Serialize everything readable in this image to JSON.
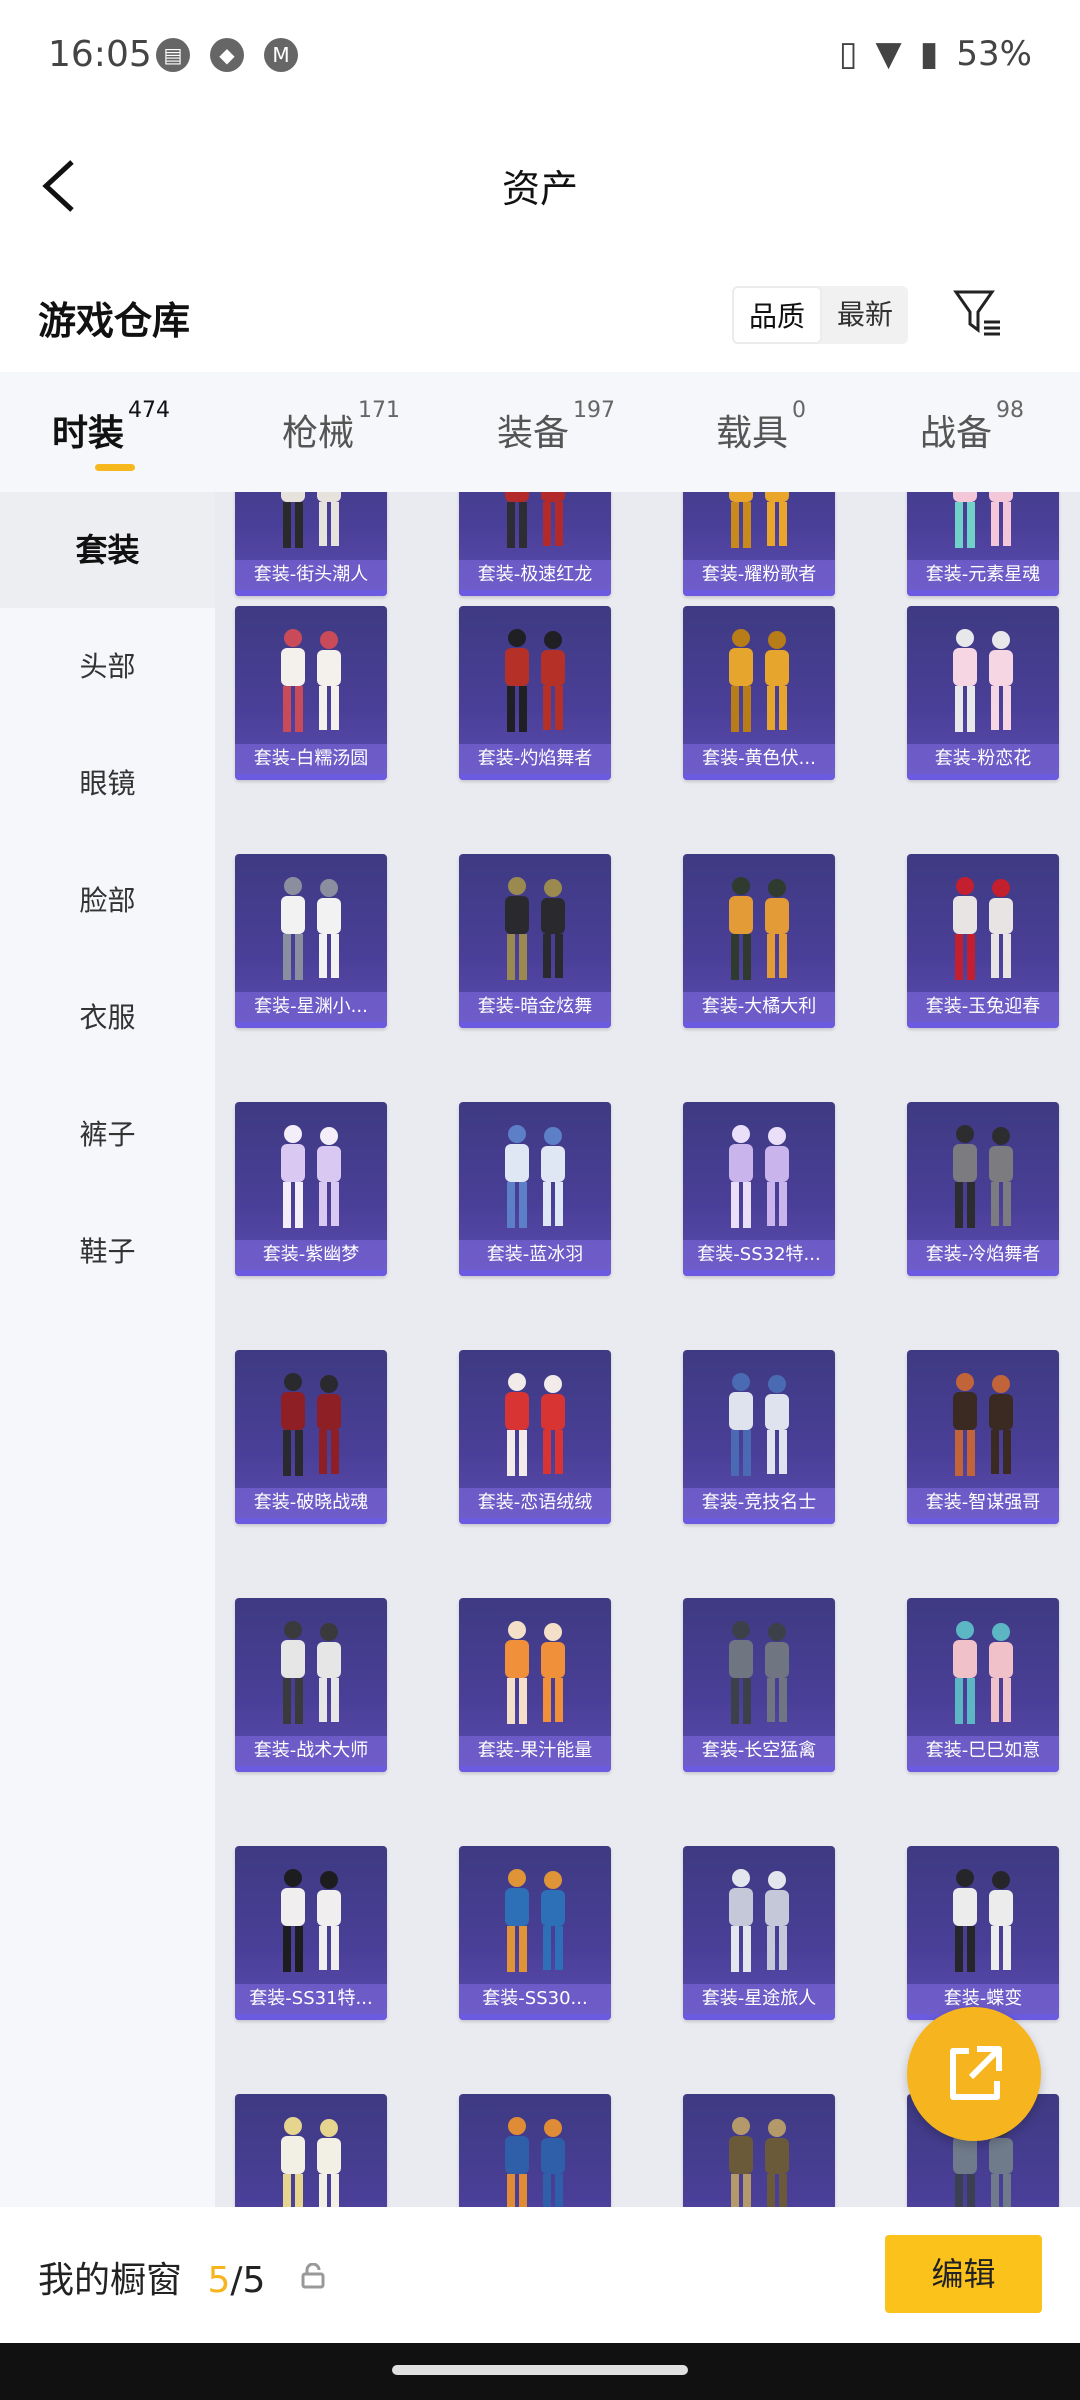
{
  "status_bar": {
    "time": "16:05",
    "battery": "53%",
    "icons": [
      "calendar-icon",
      "shield-icon",
      "motorola-icon",
      "vibrate-icon",
      "wifi-icon",
      "battery-icon"
    ]
  },
  "header": {
    "title": "资产"
  },
  "section": {
    "title": "游戏仓库",
    "sort_options": [
      "品质",
      "最新"
    ],
    "sort_selected": "品质"
  },
  "tabs": [
    {
      "label": "时装",
      "count": "474"
    },
    {
      "label": "枪械",
      "count": "171"
    },
    {
      "label": "装备",
      "count": "197"
    },
    {
      "label": "载具",
      "count": "0"
    },
    {
      "label": "战备",
      "count": "98"
    }
  ],
  "sidebar": {
    "items": [
      "套装",
      "头部",
      "眼镜",
      "脸部",
      "衣服",
      "裤子",
      "鞋子"
    ]
  },
  "grid": {
    "items": [
      "套装-街头潮人",
      "套装-极速红龙",
      "套装-耀粉歌者",
      "套装-元素星魂",
      "套装-白糯汤圆",
      "套装-灼焰舞者",
      "套装-黄色伏...",
      "套装-粉恋花",
      "套装-星渊小...",
      "套装-暗金炫舞",
      "套装-大橘大利",
      "套装-玉兔迎春",
      "套装-紫幽梦",
      "套装-蓝冰羽",
      "套装-SS32特...",
      "套装-冷焰舞者",
      "套装-破晓战魂",
      "套装-恋语绒绒",
      "套装-竞技名士",
      "套装-智谋强哥",
      "套装-战术大师",
      "套装-果汁能量",
      "套装-长空猛禽",
      "套装-巳巳如意",
      "套装-SS31特...",
      "套装-SS30...",
      "套装-星途旅人",
      "套装-蝶变",
      "",
      "",
      "",
      ""
    ]
  },
  "colors": {
    "accent": "#f6b41e",
    "card_bg": "#44398e"
  },
  "bottom_bar": {
    "label": "我的橱窗",
    "current": "5",
    "separator": "/",
    "total": "5",
    "edit_label": "编辑"
  }
}
